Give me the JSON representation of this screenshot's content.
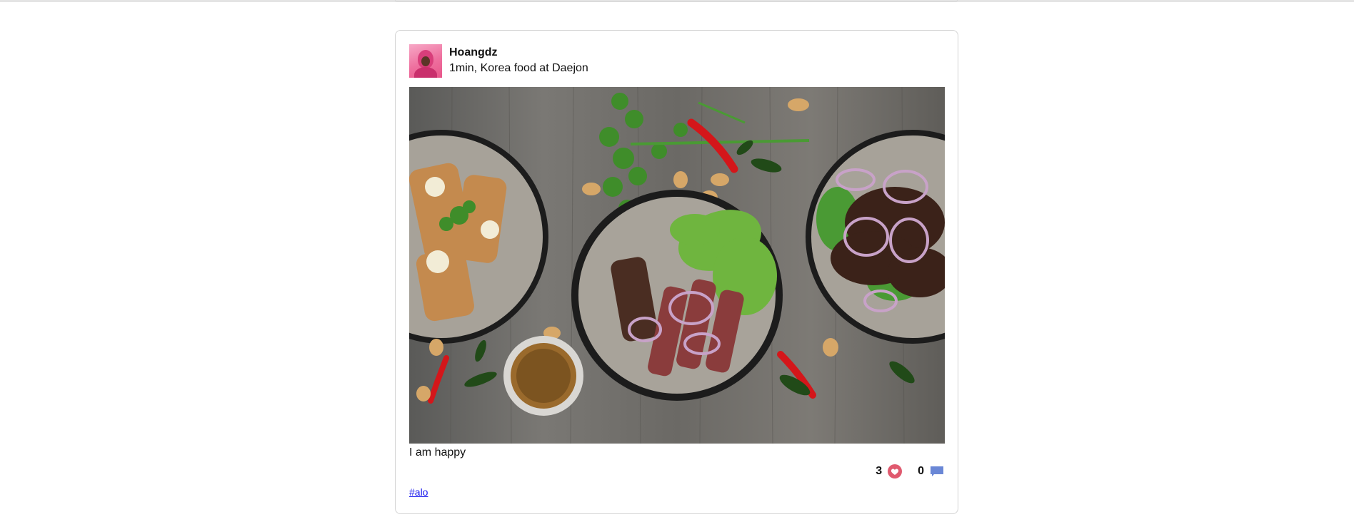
{
  "post": {
    "author": "Hoangdz",
    "meta": "1min, Korea food at Daejon",
    "caption": "I am happy",
    "likes": "3",
    "comments": "0",
    "hashtag": "#alo"
  },
  "icons": {
    "like": "heart-icon",
    "comment": "comment-icon"
  },
  "colors": {
    "heart": "#e05a6f",
    "comment": "#6a87d6",
    "link": "#1a1aee"
  }
}
